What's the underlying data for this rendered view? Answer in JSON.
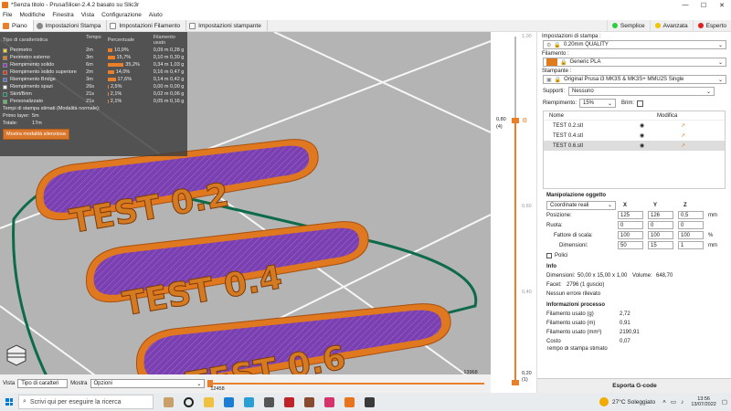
{
  "window": {
    "title": "*Senza titolo - PrusaSlicer-2.4.2 basato su Slic3r"
  },
  "menu": [
    "File",
    "Modifiche",
    "Finestra",
    "Vista",
    "Configurazione",
    "Aiuto"
  ],
  "tabs": [
    "Piano",
    "Impostazioni Stampa",
    "Impostazioni Filamento",
    "Impostazioni stampante"
  ],
  "modes": [
    {
      "label": "Semplice",
      "color": "#2ecc40"
    },
    {
      "label": "Avanzata",
      "color": "#f2c500"
    },
    {
      "label": "Esperto",
      "color": "#e02020"
    }
  ],
  "legend": {
    "headers": [
      "Tipo di caratteristica",
      "Tempo",
      "Percentuale",
      "Filamento usato"
    ],
    "rows": [
      {
        "name": "Perimetro",
        "time": "2m",
        "perc": "10,9%",
        "fil": "0,09 m  0,28 g",
        "color": "#f5d62a",
        "pct": 10.9
      },
      {
        "name": "Perimetro esterno",
        "time": "3m",
        "perc": "15,7%",
        "fil": "0,10 m  0,30 g",
        "color": "#f07b12",
        "pct": 15.7
      },
      {
        "name": "Riempimento solido",
        "time": "6m",
        "perc": "35,2%",
        "fil": "0,34 m  1,03 g",
        "color": "#8a3fbf",
        "pct": 35.2
      },
      {
        "name": "Riempimento solido superiore",
        "time": "2m",
        "perc": "14,0%",
        "fil": "0,16 m  0,47 g",
        "color": "#e03020",
        "pct": 14.0
      },
      {
        "name": "Riempimento Bridge",
        "time": "3m",
        "perc": "17,6%",
        "fil": "0,14 m  0,42 g",
        "color": "#4a74c9",
        "pct": 17.6
      },
      {
        "name": "Riempimento spazi",
        "time": "26s",
        "perc": "2,5%",
        "fil": "0,00 m  0,00 g",
        "color": "#ffffff",
        "pct": 2.5
      },
      {
        "name": "Skirt/Brim",
        "time": "21s",
        "perc": "2,1%",
        "fil": "0,02 m  0,06 g",
        "color": "#0e7a55",
        "pct": 2.1
      },
      {
        "name": "Personalizzato",
        "time": "21s",
        "perc": "2,1%",
        "fil": "0,05 m  0,16 g",
        "color": "#5ac36a",
        "pct": 2.1
      }
    ],
    "estimate_title": "Tempi di stampa stimati (Modalità normale):",
    "first_layer_label": "Primo layer:",
    "first_layer": "5m",
    "total_label": "Totale:",
    "total": "17m",
    "silent_button": "Mostra modalità silenziosa"
  },
  "models": [
    "TEST 0.2",
    "TEST 0.4",
    "TEST 0.6"
  ],
  "bottom": {
    "view_label": "Vista",
    "view_value": "Tipo di caratteri",
    "show_label": "Mostra",
    "show_value": "Opzioni",
    "h_top": "13968",
    "h_bottom": "12458"
  },
  "vslider": {
    "top": "1,00",
    "mid_val": "0,80",
    "mid_idx": "(4)",
    "t1": "0,60",
    "t2": "0,40",
    "bot_val": "0,20",
    "bot_idx": "(1)"
  },
  "sidebar": {
    "print_label": "Impostazioni di stampa :",
    "print_value": "0.20mm QUALITY",
    "filament_label": "Filamento :",
    "filament_value": "Generic PLA",
    "filament_color": "#e07a1c",
    "printer_label": "Stampante :",
    "printer_value": "Original Prusa i3 MK3S & MK3S+ MMU2S Single",
    "supports_label": "Supporti:",
    "supports_value": "Nessuno",
    "infill_label": "Riempimento:",
    "infill_value": "15%",
    "brim_label": "Brim:",
    "table_headers": [
      "Nome",
      "Modifica"
    ],
    "objects": [
      "TEST 0.2.stl",
      "TEST 0.4.stl",
      "TEST 0.6.stl"
    ],
    "manip_title": "Manipolazione oggetto",
    "coords_value": "Coordinate reali",
    "axes": [
      "X",
      "Y",
      "Z"
    ],
    "position_label": "Posizione:",
    "position": [
      "125",
      "126",
      "0,5"
    ],
    "position_unit": "mm",
    "rotation_label": "Ruota:",
    "rotation": [
      "0",
      "0",
      "0"
    ],
    "scale_label": "Fattore di scala:",
    "scale": [
      "100",
      "100",
      "100"
    ],
    "scale_unit": "%",
    "size_label": "Dimensioni:",
    "size": [
      "50",
      "15",
      "1"
    ],
    "size_unit": "mm",
    "polish_label": "Polici",
    "info_title": "Info",
    "dim_label": "Dimensioni:",
    "dim_value": "50,00 x 15,00 x 1,00",
    "vol_label": "Volume:",
    "vol_value": "648,70",
    "facets_label": "Facet:",
    "facets_value": "2796 (1 guscio)",
    "errors": "Nessun errore rilevato",
    "proc_title": "Informazioni processo",
    "fil_g_label": "Filamento usato (g)",
    "fil_g": "2,72",
    "fil_m_label": "Filamento usato (m)",
    "fil_m": "0,91",
    "fil_mm3_label": "Filamento usato (mm³)",
    "fil_mm3": "2190,91",
    "cost_label": "Costo",
    "cost": "0,07",
    "time_label": "Tempo di stampa stimato",
    "export_button": "Esporta G-code"
  },
  "taskbar": {
    "search_placeholder": "Scrivi qui per eseguire la ricerca",
    "weather": "27°C  Soleggiato",
    "time": "13:56",
    "date": "13/07/2022"
  }
}
